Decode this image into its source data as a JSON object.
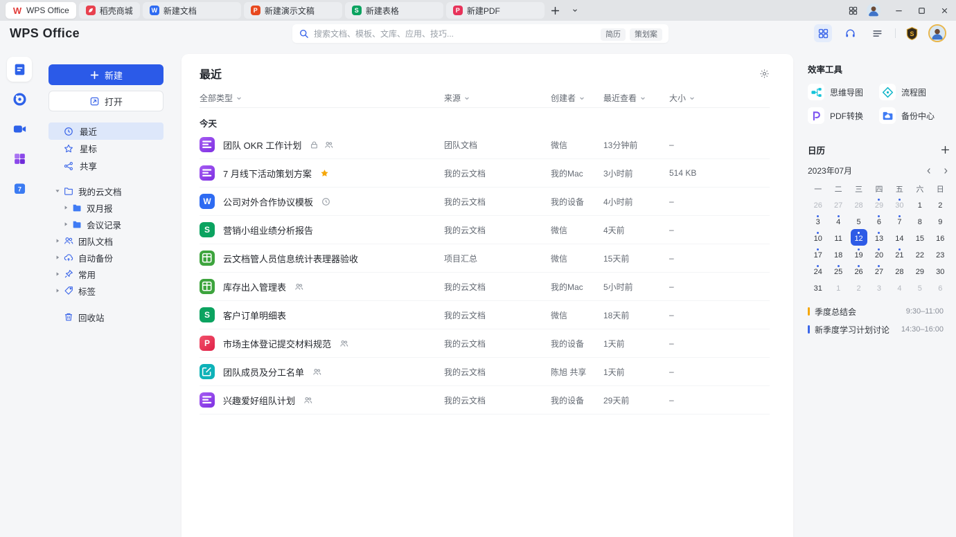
{
  "colors": {
    "accent": "#2b5ae8"
  },
  "tabbar": {
    "tabs": [
      {
        "name": "wps-office",
        "label": "WPS Office",
        "icon": "wps-logo",
        "kind": "app",
        "active": true
      },
      {
        "name": "docer-store",
        "label": "稻壳商城",
        "icon": "docer",
        "kind": "app",
        "active": false
      },
      {
        "name": "new-doc",
        "label": "新建文档",
        "icon": "writer",
        "kind": "doc",
        "active": false
      },
      {
        "name": "new-ppt",
        "label": "新建演示文稿",
        "icon": "ppt",
        "kind": "doc",
        "active": false
      },
      {
        "name": "new-sheet",
        "label": "新建表格",
        "icon": "sheet",
        "kind": "doc",
        "active": false
      },
      {
        "name": "new-pdf",
        "label": "新建PDF",
        "icon": "pdf",
        "kind": "doc",
        "active": false
      }
    ]
  },
  "header": {
    "logo": "WPS Office",
    "search_placeholder": "搜索文档、模板、文库、应用、技巧...",
    "search_tags": [
      "简历",
      "策划案"
    ]
  },
  "rail": [
    {
      "name": "documents",
      "icon": "rail-docs",
      "active": true
    },
    {
      "name": "recent-circle",
      "icon": "rail-clock",
      "active": false
    },
    {
      "name": "meeting",
      "icon": "rail-meeting",
      "active": false
    },
    {
      "name": "apps",
      "icon": "rail-apps",
      "active": false
    },
    {
      "name": "calendar",
      "icon": "rail-calendar",
      "active": false
    }
  ],
  "sidebar": {
    "new_button": "新建",
    "open_button": "打开",
    "nav": [
      {
        "name": "recent",
        "icon": "clock",
        "label": "最近",
        "active": true
      },
      {
        "name": "starred",
        "icon": "star",
        "label": "星标",
        "active": false
      },
      {
        "name": "shared",
        "icon": "share",
        "label": "共享",
        "active": false
      }
    ],
    "tree": [
      {
        "name": "my-cloud-docs",
        "label": "我的云文档",
        "icon": "folder-outline",
        "caret": "down",
        "level": 0
      },
      {
        "name": "bimonthly-report",
        "label": "双月报",
        "icon": "folder-filled",
        "caret": "right",
        "level": 1
      },
      {
        "name": "meeting-notes",
        "label": "会议记录",
        "icon": "folder-filled",
        "caret": "right",
        "level": 1
      },
      {
        "name": "team-docs",
        "label": "团队文档",
        "icon": "team",
        "caret": "right",
        "level": 0
      },
      {
        "name": "auto-backup",
        "label": "自动备份",
        "icon": "cloud-backup",
        "caret": "right",
        "level": 0
      },
      {
        "name": "frequent",
        "label": "常用",
        "icon": "pin",
        "caret": "right",
        "level": 0
      },
      {
        "name": "tags",
        "label": "标签",
        "icon": "tag",
        "caret": "right",
        "level": 0
      }
    ],
    "trash": {
      "name": "trash",
      "label": "回收站"
    }
  },
  "main": {
    "title": "最近",
    "filters": [
      {
        "name": "type",
        "label": "全部类型"
      },
      {
        "name": "source",
        "label": "来源"
      },
      {
        "name": "creator",
        "label": "创建者"
      },
      {
        "name": "viewed",
        "label": "最近查看"
      },
      {
        "name": "size",
        "label": "大小"
      }
    ],
    "section": "今天",
    "files": [
      {
        "icon": "docs-purple",
        "title": "团队 OKR 工作计划",
        "badges": [
          "lock",
          "members"
        ],
        "source": "团队文档",
        "creator": "微信",
        "viewed": "13分钟前",
        "size": "–"
      },
      {
        "icon": "docs-purple",
        "title": "7 月线下活动策划方案",
        "badges": [
          "star"
        ],
        "source": "我的云文档",
        "creator": "我的Mac",
        "viewed": "3小时前",
        "size": "514 KB"
      },
      {
        "icon": "word-blue",
        "title": "公司对外合作协议模板",
        "badges": [
          "clock"
        ],
        "source": "我的云文档",
        "creator": "我的设备",
        "viewed": "4小时前",
        "size": "–"
      },
      {
        "icon": "sheet-green",
        "title": "营销小组业绩分析报告",
        "badges": [],
        "source": "我的云文档",
        "creator": "微信",
        "viewed": "4天前",
        "size": "–"
      },
      {
        "icon": "smartsheet-green",
        "title": "云文档管人员信息统计表理器验收",
        "badges": [],
        "source": "项目汇总",
        "creator": "微信",
        "viewed": "15天前",
        "size": "–"
      },
      {
        "icon": "smartsheet-green",
        "title": "库存出入管理表",
        "badges": [
          "members"
        ],
        "source": "我的云文档",
        "creator": "我的Mac",
        "viewed": "5小时前",
        "size": "–"
      },
      {
        "icon": "sheet-green",
        "title": "客户订单明细表",
        "badges": [],
        "source": "我的云文档",
        "creator": "微信",
        "viewed": "18天前",
        "size": "–"
      },
      {
        "icon": "pdf-red",
        "title": "市场主体登记提交材料规范",
        "badges": [
          "members"
        ],
        "source": "我的云文档",
        "creator": "我的设备",
        "viewed": "1天前",
        "size": "–"
      },
      {
        "icon": "form-teal",
        "title": "团队成员及分工名单",
        "badges": [
          "members"
        ],
        "source": "我的云文档",
        "creator": "陈旭 共享",
        "viewed": "1天前",
        "size": "–"
      },
      {
        "icon": "docs-purple",
        "title": "兴趣爱好组队计划",
        "badges": [
          "members"
        ],
        "source": "我的云文档",
        "creator": "我的设备",
        "viewed": "29天前",
        "size": "–"
      }
    ]
  },
  "right": {
    "tools_title": "效率工具",
    "tools": [
      {
        "name": "mindmap",
        "icon": "mindmap",
        "label": "思维导图"
      },
      {
        "name": "flowchart",
        "icon": "flowchart",
        "label": "流程图"
      },
      {
        "name": "pdf-convert",
        "icon": "pdf-convert",
        "label": "PDF转换"
      },
      {
        "name": "backup-center",
        "icon": "backup",
        "label": "备份中心"
      }
    ],
    "calendar": {
      "title": "日历",
      "month": "2023年07月",
      "weekdays": [
        "一",
        "二",
        "三",
        "四",
        "五",
        "六",
        "日"
      ],
      "days": [
        {
          "d": 26,
          "muted": true
        },
        {
          "d": 27,
          "muted": true
        },
        {
          "d": 28,
          "muted": true
        },
        {
          "d": 29,
          "muted": true,
          "dot": true
        },
        {
          "d": 30,
          "muted": true,
          "dot": true
        },
        {
          "d": 1
        },
        {
          "d": 2
        },
        {
          "d": 3,
          "dot": true
        },
        {
          "d": 4,
          "dot": true
        },
        {
          "d": 5
        },
        {
          "d": 6,
          "dot": true
        },
        {
          "d": 7,
          "dot": true
        },
        {
          "d": 8
        },
        {
          "d": 9
        },
        {
          "d": 10,
          "dot": true
        },
        {
          "d": 11
        },
        {
          "d": 12,
          "selected": true,
          "dot": true
        },
        {
          "d": 13,
          "dot": true
        },
        {
          "d": 14
        },
        {
          "d": 15
        },
        {
          "d": 16
        },
        {
          "d": 17,
          "dot": true
        },
        {
          "d": 18
        },
        {
          "d": 19,
          "dot": true
        },
        {
          "d": 20,
          "dot": true
        },
        {
          "d": 21,
          "dot": true
        },
        {
          "d": 22
        },
        {
          "d": 23
        },
        {
          "d": 24,
          "dot": true
        },
        {
          "d": 25,
          "dot": true
        },
        {
          "d": 26,
          "dot": true
        },
        {
          "d": 27,
          "dot": true
        },
        {
          "d": 28
        },
        {
          "d": 29
        },
        {
          "d": 30
        },
        {
          "d": 31
        },
        {
          "d": 1,
          "muted": true
        },
        {
          "d": 2,
          "muted": true
        },
        {
          "d": 3,
          "muted": true
        },
        {
          "d": 4,
          "muted": true
        },
        {
          "d": 5,
          "muted": true
        },
        {
          "d": 6,
          "muted": true
        }
      ],
      "events": [
        {
          "title": "季度总结会",
          "time": "9:30–11:00",
          "color": "#f5a70a"
        },
        {
          "title": "新季度学习计划讨论",
          "time": "14:30–16:00",
          "color": "#3b66e9"
        }
      ]
    }
  }
}
